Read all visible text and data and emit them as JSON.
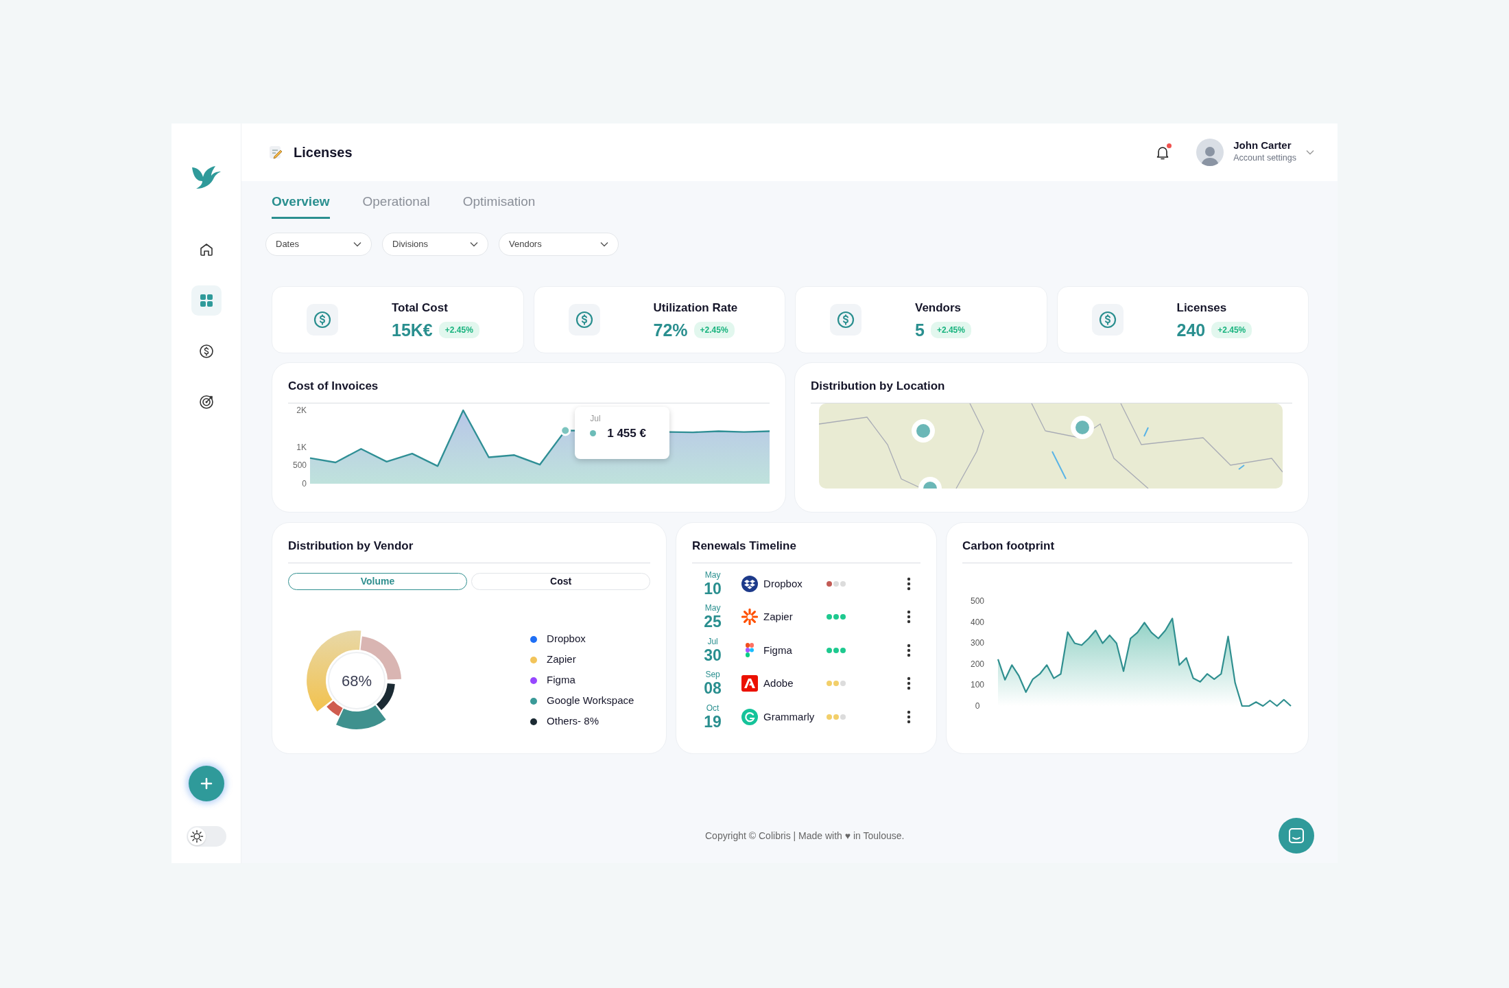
{
  "sidebar": {
    "nav_items": [
      {
        "selected": false
      },
      {
        "selected": true
      },
      {
        "selected": false
      },
      {
        "selected": false
      }
    ],
    "theme_toggle": {
      "on": false
    }
  },
  "header": {
    "title": "Licenses",
    "notification": {
      "unread": true
    },
    "user": {
      "name": "John Carter",
      "subtitle": "Account settings"
    }
  },
  "tabs": [
    {
      "label": "Overview",
      "selected": true
    },
    {
      "label": "Operational",
      "selected": false
    },
    {
      "label": "Optimisation",
      "selected": false
    }
  ],
  "filters": [
    {
      "label": "Dates"
    },
    {
      "label": "Divisions"
    },
    {
      "label": "Vendors"
    }
  ],
  "kpis": [
    {
      "title": "Total Cost",
      "value": "15K€",
      "change": "+2.45%"
    },
    {
      "title": "Utilization Rate",
      "value": "72%",
      "change": "+2.45%"
    },
    {
      "title": "Vendors",
      "value": "5",
      "change": "+2.45%"
    },
    {
      "title": "Licenses",
      "value": "240",
      "change": "+2.45%"
    }
  ],
  "cost_of_invoices": {
    "title": "Cost of Invoices",
    "tooltip": {
      "month": "Jul",
      "value": "1 455 €"
    },
    "chart_data": {
      "type": "area",
      "ylim": [
        0,
        2000
      ],
      "yticks": [
        0,
        500,
        {
          "value": 1000,
          "label": "1K"
        },
        {
          "value": 2000,
          "label": "2K"
        }
      ],
      "categories": [
        null,
        null,
        null,
        null,
        null,
        null,
        null,
        null,
        null,
        null,
        null,
        null,
        null,
        null,
        null,
        null,
        null,
        null,
        null
      ],
      "series": [
        {
          "color": "#2f8f95",
          "values": [
            700,
            580,
            950,
            600,
            820,
            480,
            2000,
            720,
            780,
            520,
            1450,
            null,
            null,
            null,
            null,
            1400,
            1430,
            1410,
            1430
          ]
        }
      ]
    }
  },
  "distribution_by_location": {
    "title": "Distribution by Location"
  },
  "distribution_by_vendor": {
    "title": "Distribution by Vendor",
    "toggle": [
      {
        "label": "Volume",
        "selected": true
      },
      {
        "label": "Cost",
        "selected": false
      }
    ],
    "center_label": "68%",
    "legend": [
      {
        "label": "Dropbox",
        "color": "#1f6ff5"
      },
      {
        "label": "Zapier",
        "color": "#f2c45a"
      },
      {
        "label": "Figma",
        "color": "#9747ff"
      },
      {
        "label": "Google Workspace",
        "color": "#3a9a98"
      },
      {
        "label": "Others- 8%",
        "color": "#1b2a33"
      }
    ]
  },
  "renewals_timeline": {
    "title": "Renewals Timeline",
    "rows": [
      {
        "month": "May",
        "day": "10",
        "vendor": "Dropbox",
        "stars": 1,
        "color": "#c25b55"
      },
      {
        "month": "May",
        "day": "25",
        "vendor": "Zapier",
        "stars": 3,
        "color": "#1ec98f"
      },
      {
        "month": "Jul",
        "day": "30",
        "vendor": "Figma",
        "stars": 3,
        "color": "#1ec98f"
      },
      {
        "month": "Sep",
        "day": "08",
        "vendor": "Adobe",
        "stars": 2,
        "color": "#f2cf6a"
      },
      {
        "month": "Oct",
        "day": "19",
        "vendor": "Grammarly",
        "stars": 2,
        "color": "#f2cf6a"
      }
    ]
  },
  "carbon_footprint": {
    "title": "Carbon footprint",
    "chart_data": {
      "type": "area",
      "ylim": [
        0,
        500
      ],
      "yticks": [
        0,
        100,
        200,
        300,
        400,
        500
      ],
      "categories": [
        null,
        null,
        null,
        null,
        null,
        null,
        null,
        null,
        null,
        null,
        null,
        null,
        null,
        null,
        null,
        null,
        null,
        null,
        null,
        null,
        null,
        null,
        null,
        null,
        null,
        null,
        null,
        null,
        null,
        null,
        null,
        null,
        null,
        null,
        null,
        null,
        null,
        null,
        null,
        null,
        null,
        null,
        null
      ],
      "series": [
        {
          "color": "#2f8f8f",
          "values": [
            223,
            125,
            195,
            143,
            66,
            128,
            153,
            195,
            132,
            153,
            352,
            299,
            290,
            322,
            360,
            299,
            337,
            299,
            166,
            322,
            350,
            397,
            350,
            322,
            360,
            417,
            195,
            229,
            132,
            115,
            153,
            128,
            153,
            331,
            110,
            0,
            0,
            19,
            0,
            26,
            0,
            30,
            0
          ]
        }
      ]
    }
  },
  "footer": {
    "text": "Copyright © Colibris | Made with ♥ in Toulouse."
  }
}
